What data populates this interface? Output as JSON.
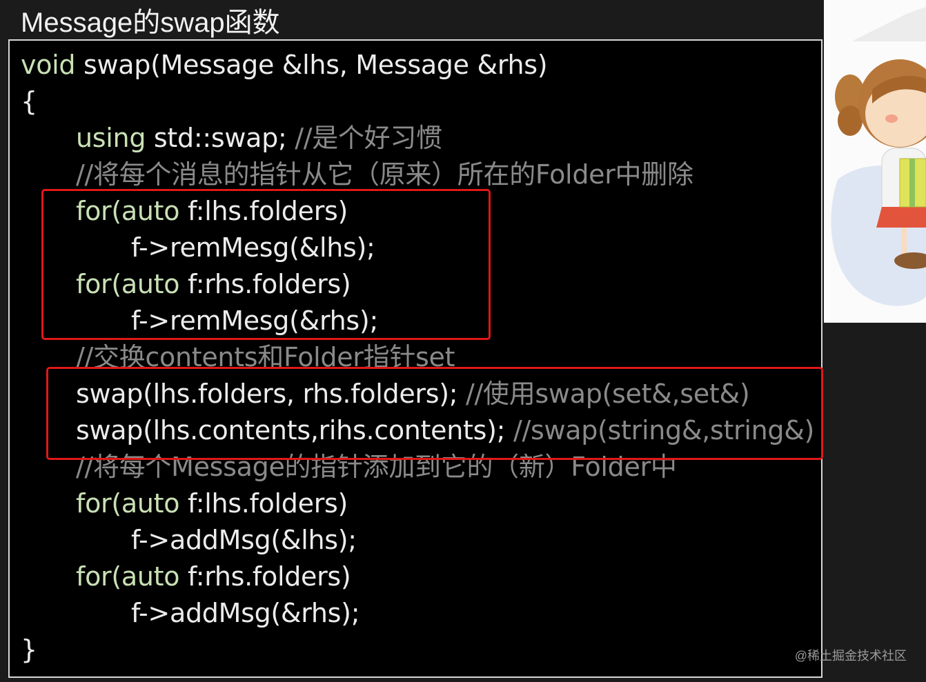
{
  "title": "Message的swap函数",
  "code": {
    "line1": {
      "kw": "void",
      "text": " swap(Message &lhs, Message &rhs)"
    },
    "line2": "{",
    "line3": {
      "kw": "using",
      "text": " std::swap; ",
      "comment": "//是个好习惯"
    },
    "line4": "//将每个消息的指针从它（原来）所在的Folder中删除",
    "line5": {
      "kw1": "for(auto",
      "text": " f:lhs.folders)"
    },
    "line6": "f->remMesg(&lhs);",
    "line7": {
      "kw1": "for(auto",
      "text": " f:rhs.folders)"
    },
    "line8": "f->remMesg(&rhs);",
    "line9": "//交换contents和Folder指针set",
    "line10": {
      "text": "swap(lhs.folders, rhs.folders); ",
      "comment": "//使用swap(set&,set&)"
    },
    "line11": {
      "text": "swap(lhs.contents,rihs.contents); ",
      "comment": "//swap(string&,string&)"
    },
    "line12": "//将每个Message的指针添加到它的（新）Folder中",
    "line13": {
      "kw1": "for(auto",
      "text": " f:lhs.folders)"
    },
    "line14": "f->addMsg(&lhs);",
    "line15": {
      "kw1": "for(auto",
      "text": " f:rhs.folders)"
    },
    "line16": "f->addMsg(&rhs);",
    "line17": "}"
  },
  "watermark": "@稀土掘金技术社区",
  "colors": {
    "keyword": "#c9e1b5",
    "comment": "#8a8a8a",
    "text": "#ececec",
    "highlight_box": "#e01818",
    "background": "#000000"
  }
}
